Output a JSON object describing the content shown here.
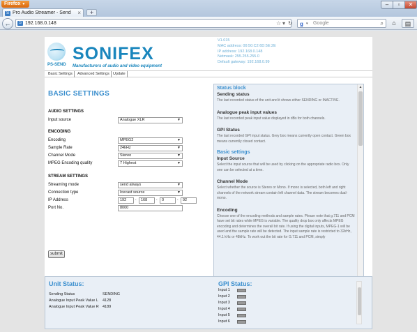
{
  "browser": {
    "menu_button": "Firefox",
    "tab_title": "Pro Audio Streamer - Send",
    "url": "192.168.0.148",
    "search_placeholder": "Google",
    "newtab_label": "+"
  },
  "header": {
    "brand": "SONIFEX",
    "logo_sub": "PS-SEND",
    "tagline": "Manufacturers of audio and video equipment",
    "device_info": [
      "V1.015",
      "MAC address: 00:50:C2:6D:5E:2E",
      "IP address: 192.168.0.148",
      "Netmask: 255.255.255.0",
      "Default gateway: 192.168.0.99"
    ]
  },
  "nav_tabs": [
    "Basic Settings",
    "Advanced Settings",
    "Update"
  ],
  "settings": {
    "title": "BASIC SETTINGS",
    "audio_heading": "AUDIO SETTINGS",
    "input_source_label": "Input source",
    "input_source_value": "Analogue XLR",
    "encoding_heading": "ENCODING",
    "encoding_label": "Encoding",
    "encoding_value": "MPEG2",
    "sample_rate_label": "Sample Rate",
    "sample_rate_value": "24kHz",
    "channel_mode_label": "Channel Mode",
    "channel_mode_value": "Stereo",
    "quality_label": "MPEG Encoding quality",
    "quality_value": "7 Highest",
    "stream_heading": "STREAM SETTINGS",
    "streaming_mode_label": "Streaming mode",
    "streaming_mode_value": "send always",
    "connection_type_label": "Connection type",
    "connection_type_value": "Icecast source",
    "ip_label": "IP Address",
    "ip": [
      "192",
      "168",
      "0",
      "92"
    ],
    "port_label": "Port No.",
    "port_value": "8000",
    "submit_label": "submit"
  },
  "status_help": {
    "block_title": "Status block",
    "sending_title": "Sending status",
    "sending_text": "The last recorded status of the unit and it shows either SENDING or INACTIVE.",
    "peak_title": "Analogue peak input values",
    "peak_text": "The last recorded peak input value displayed in dBs for both channels.",
    "gpi_title": "GPI Status",
    "gpi_text": "The last recorded GPI input status. Grey box means currently open contact. Green box means currently closed contact.",
    "basic_title": "Basic settings",
    "input_title": "Input Source",
    "input_text": "Select the input source that will be used by clicking on the appropriate radio box. Only one can be selected at a time.",
    "channel_title": "Channel Mode",
    "channel_text": "Select whether the source is Stereo or Mono. If mono is selected, both left and right channels of the network stream contain left channel data. The stream becomes dual-mono.",
    "encoding_title": "Encoding",
    "encoding_text": "Choose one of the encoding methods and sample rates. Please note that g.711 and PCM have set bit rates while MPEG is variable. The quality drop box only affects MPEG encoding and determines the overall bit rate. If using the digital inputs, MPEG-1 will be used and the sample rate will be detected. The input sample rate is restricted to 32kHz, 44.1 kHz or 48kHz. To work out the bit rate for G.711 and PCM, simply"
  },
  "unit_status": {
    "title": "Unit Status:",
    "sending_label": "Sending Status",
    "sending_value": "SENDING",
    "peak_l_label": "Analogue Input Peak Value L",
    "peak_l_value": "4128",
    "peak_r_label": "Analogue Input Peak Value R",
    "peak_r_value": "4189"
  },
  "gpi_status": {
    "title": "GPI Status:",
    "inputs": [
      "Input 1",
      "Input 2",
      "Input 3",
      "Input 4",
      "Input 5",
      "Input 6"
    ]
  }
}
